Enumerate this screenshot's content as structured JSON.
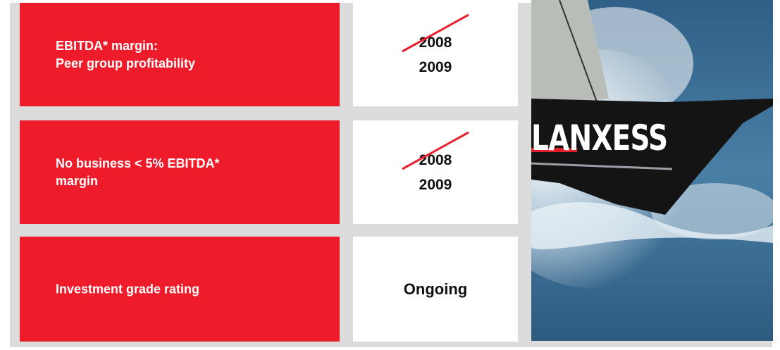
{
  "rows": [
    {
      "label": "EBITDA* margin:\nPeer group profitability",
      "line1": "EBITDA* margin:",
      "line2": "Peer group profitability",
      "year_old": "2008",
      "year_new": "2009",
      "status": ""
    },
    {
      "line1": "No business < 5% EBITDA*",
      "line2": "margin",
      "year_old": "2008",
      "year_new": "2009",
      "status": ""
    },
    {
      "line1": "Investment grade rating",
      "line2": "",
      "status": "Ongoing"
    }
  ],
  "photo": {
    "logo_text": "LANXESS"
  },
  "colors": {
    "accent_red": "#ee1c2b",
    "panel_gray": "#dcdcdc",
    "strike_red": "#e8202e"
  }
}
